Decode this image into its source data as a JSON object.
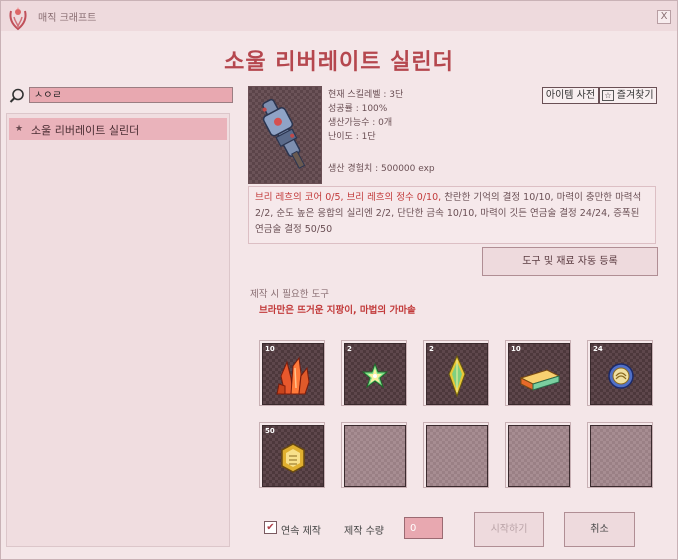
{
  "window": {
    "title": "매직 크래프트",
    "close_label": "X"
  },
  "recipe": {
    "title": "소울 리버레이트 실린더"
  },
  "search": {
    "value": "ㅅㅇㄹ",
    "icon": "search-icon"
  },
  "list": {
    "items": [
      {
        "label": "소울 리버레이트 실린더",
        "selected": true
      }
    ]
  },
  "stats": {
    "skill_level": "현재 스킬레벨 : 3단",
    "success_rate": "성공률 : 100%",
    "craftable": "생산가능수 : 0개",
    "difficulty": "난이도 : 1단",
    "exp": "생산 경험치 : 500000 exp"
  },
  "top_buttons": {
    "item_dict": "아이템 사전",
    "favorite": "즐겨찾기"
  },
  "ingredients": {
    "missing": "브리 레흐의 코어 0/5, 브리 레흐의 정수 0/10,",
    "have": " 찬란한 기억의 결정 10/10, 마력이 충만한 마력석 2/2, 순도 높은 응합의 실리엔 2/2, 단단한 금속 10/10, 마력이 깃든 연금술 결정 24/24, 증폭된 연금술 결정 50/50"
  },
  "auto_register_label": "도구 및 재료 자동 등록",
  "tools": {
    "label": "제작 시 필요한 도구",
    "list": "브라만은 뜨거운 지팡이, 마법의 가마솥"
  },
  "slots": [
    {
      "count": "10",
      "icon": "orange-crystal-icon"
    },
    {
      "count": "2",
      "icon": "green-star-shard-icon"
    },
    {
      "count": "2",
      "icon": "yellow-gem-icon"
    },
    {
      "count": "10",
      "icon": "metal-ingot-icon"
    },
    {
      "count": "24",
      "icon": "blue-crystal-orb-icon"
    },
    {
      "count": "50",
      "icon": "amplified-crystal-icon"
    },
    {
      "count": "",
      "icon": ""
    },
    {
      "count": "",
      "icon": ""
    },
    {
      "count": "",
      "icon": ""
    },
    {
      "count": "",
      "icon": ""
    }
  ],
  "bottom": {
    "continuous_label": "연속 제작",
    "continuous_checked": true,
    "qty_label": "제작 수량",
    "qty_value": "0",
    "start_label": "시작하기",
    "cancel_label": "취소"
  }
}
